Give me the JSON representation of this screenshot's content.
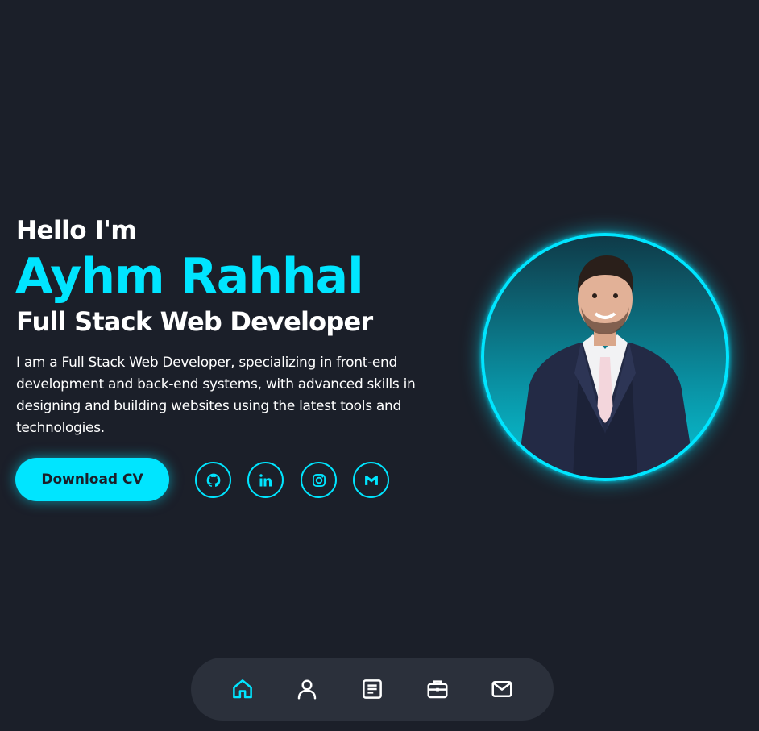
{
  "hero": {
    "greeting": "Hello I'm",
    "name": "Ayhm Rahhal",
    "role": "Full Stack Web Developer",
    "bio": "I am a Full Stack Web Developer, specializing in front-end development and back-end systems, with advanced skills in designing and building websites using the latest tools and technologies.",
    "cv_button": "Download CV"
  },
  "social": [
    {
      "icon": "github-icon"
    },
    {
      "icon": "linkedin-icon"
    },
    {
      "icon": "instagram-icon"
    },
    {
      "icon": "gmail-icon"
    }
  ],
  "dock": [
    {
      "icon": "home-icon",
      "active": true
    },
    {
      "icon": "user-icon",
      "active": false
    },
    {
      "icon": "article-icon",
      "active": false
    },
    {
      "icon": "briefcase-icon",
      "active": false
    },
    {
      "icon": "mail-icon",
      "active": false
    }
  ],
  "colors": {
    "accent": "#00e5ff",
    "background": "#1b1f29",
    "dock": "#2b303b",
    "text": "#ffffff"
  }
}
